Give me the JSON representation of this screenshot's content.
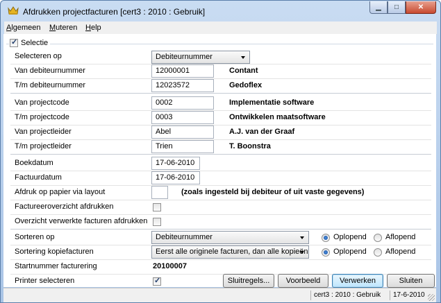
{
  "window": {
    "title": "Afdrukken projectfacturen  [cert3 : 2010 : Gebruik]",
    "minimize_glyph": "▁",
    "maximize_glyph": "□",
    "close_glyph": "✕",
    "app_icon": "crown-icon"
  },
  "menu": {
    "items": [
      "Algemeen",
      "Muteren",
      "Help"
    ],
    "underlines": [
      "A",
      "M",
      "H"
    ]
  },
  "selectie": {
    "label": "Selectie",
    "checked": true
  },
  "fields": {
    "selecteren_op": {
      "label": "Selecteren op",
      "value": "Debiteurnummer"
    },
    "van_debiteurnummer": {
      "label": "Van debiteurnummer",
      "value": "12000001",
      "name": "Contant"
    },
    "tm_debiteurnummer": {
      "label": "T/m debiteurnummer",
      "value": "12023572",
      "name": "Gedoflex"
    },
    "van_projectcode": {
      "label": "Van projectcode",
      "value": "0002",
      "name": "Implementatie software"
    },
    "tm_projectcode": {
      "label": "T/m projectcode",
      "value": "0003",
      "name": "Ontwikkelen maatsoftware"
    },
    "van_projectleider": {
      "label": "Van projectleider",
      "value": "Abel",
      "name": "A.J. van der Graaf"
    },
    "tm_projectleider": {
      "label": "T/m projectleider",
      "value": "Trien",
      "name": "T. Boonstra"
    },
    "boekdatum": {
      "label": "Boekdatum",
      "value": "17-06-2010"
    },
    "factuurdatum": {
      "label": "Factuurdatum",
      "value": "17-06-2010"
    },
    "afdruk_layout": {
      "label": "Afdruk op papier via layout",
      "value": "",
      "note": "(zoals ingesteld bij debiteur of uit vaste gegevens)"
    },
    "factureeroverzicht": {
      "label": "Factureeroverzicht afdrukken",
      "checked": false
    },
    "overzicht_verwerkte": {
      "label": "Overzicht verwerkte facturen afdrukken",
      "checked": false
    },
    "sorteren_op": {
      "label": "Sorteren op",
      "value": "Debiteurnummer",
      "order": "Oplopend"
    },
    "sortering_kopie": {
      "label": "Sortering kopiefacturen",
      "value": "Eerst alle originele facturen, dan alle kopieën",
      "order": "Oplopend"
    },
    "startnummer": {
      "label": "Startnummer facturering",
      "value": "20100007"
    },
    "printer": {
      "label": "Printer selecteren",
      "checked": true
    }
  },
  "radio": {
    "asc": "Oplopend",
    "desc": "Aflopend"
  },
  "buttons": {
    "sluitregels": "Sluitregels...",
    "voorbeeld": "Voorbeeld",
    "verwerken": "Verwerken",
    "sluiten": "Sluiten"
  },
  "status": {
    "context": "cert3 : 2010 : Gebruik",
    "date": "17-6-2010"
  }
}
